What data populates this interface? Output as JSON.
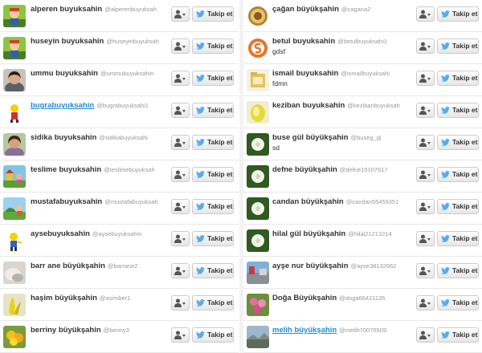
{
  "follow_label": "Takip et",
  "colors": {
    "accent": "#1f8bd6",
    "twitter_bird": "#55acee",
    "name_text": "#333333",
    "handle_text": "#999999",
    "row_border": "#e8e8e8"
  },
  "left_users": [
    {
      "name": "alperen buyuksahin",
      "handle": "@alperenbuyuksah",
      "bio": "",
      "avatar": "cartoon-character-avatar"
    },
    {
      "name": "huseyin buyuksahin",
      "handle": "@huseyinbuyuksah",
      "bio": "",
      "avatar": "cartoon-character-avatar"
    },
    {
      "name": "ummu buyuksahin",
      "handle": "@ummubuyuksahin",
      "bio": "",
      "avatar": "woman-photo-avatar"
    },
    {
      "name": "bugrabuyuksahin",
      "handle": "@bugrabuyuksahi1",
      "bio": "",
      "avatar": "cartoon-character-avatar"
    },
    {
      "name": "sidika buyuksahin",
      "handle": "@sidikabuyuksahi",
      "bio": "",
      "avatar": "woman-photo-avatar"
    },
    {
      "name": "teslime buyuksahin",
      "handle": "@teslimebuyuksah",
      "bio": "",
      "avatar": "cartoon-scene-avatar"
    },
    {
      "name": "mustafabuyuksahin",
      "handle": "@mustafabuyuksah",
      "bio": "",
      "avatar": "cartoon-scene-avatar"
    },
    {
      "name": "aysebuyuksahin",
      "handle": "@aysebuyuksahin",
      "bio": "",
      "avatar": "cartoon-character-avatar"
    },
    {
      "name": "barr ane büyükşahin",
      "handle": "@barrane2",
      "bio": "",
      "avatar": "blurred-photo-avatar"
    },
    {
      "name": "haşim büyükşahin",
      "handle": "@asimber1",
      "bio": "",
      "avatar": "yellow-object-avatar"
    },
    {
      "name": "berriny büyükşahin",
      "handle": "@beriny3",
      "bio": "",
      "avatar": "flower-avatar"
    }
  ],
  "right_users": [
    {
      "name": "çağan büyükşahin",
      "handle": "@cagana2",
      "bio": "",
      "avatar": "emblem-avatar"
    },
    {
      "name": "betul buyuksahin",
      "handle": "@betulbuyuksahi1",
      "bio": "gdsf",
      "avatar": "orange-logo-avatar"
    },
    {
      "name": "ismail buyuksahin",
      "handle": "@ismailbuyuksahi",
      "bio": "fdmn",
      "avatar": "folder-icon-avatar"
    },
    {
      "name": "keziban buyuksahin",
      "handle": "@kezibanbuyuksah",
      "bio": "",
      "avatar": "yellow-object-avatar"
    },
    {
      "name": "buse gül büyükşahin",
      "handle": "@buseg_gl",
      "bio": "sd",
      "avatar": "flower-photo-avatar"
    },
    {
      "name": "defne büyükşahin",
      "handle": "@defne15107617",
      "bio": "",
      "avatar": "flower-photo-avatar"
    },
    {
      "name": "candan büyükşahin",
      "handle": "@candan55459351",
      "bio": "",
      "avatar": "flower-photo-avatar"
    },
    {
      "name": "hilal gül büyükşahin",
      "handle": "@hilal21213214",
      "bio": "",
      "avatar": "flower-photo-avatar"
    },
    {
      "name": "ayşe nur büyükşahin",
      "handle": "@ayse38132662",
      "bio": "",
      "avatar": "street-photo-avatar"
    },
    {
      "name": "Doğa Büyükşahin",
      "handle": "@doga66421135",
      "bio": "",
      "avatar": "pink-flowers-avatar"
    },
    {
      "name": "melih büyükşahin",
      "handle": "@melih70076509",
      "bio": "",
      "avatar": "landscape-photo-avatar"
    }
  ]
}
